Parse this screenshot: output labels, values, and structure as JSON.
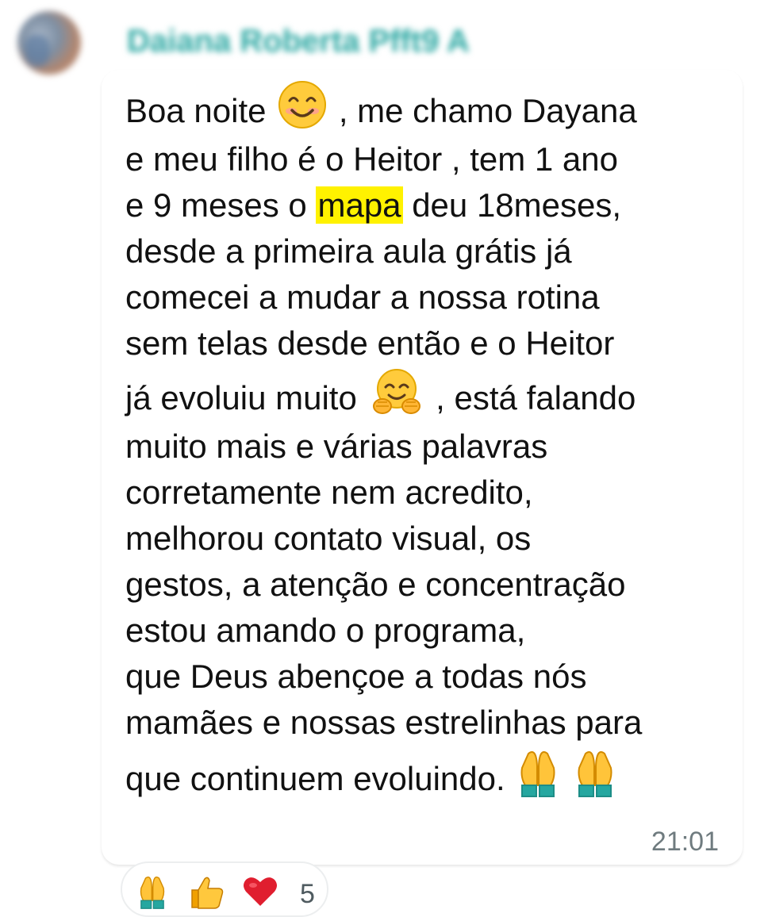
{
  "chat": {
    "sender_name": "Daiana Roberta Pfft9 A",
    "lines": [
      "Boa noite",
      ",  me chamo Dayana",
      "e meu filho é o Heitor , tem 1 ano",
      "e 9 meses o",
      "mapa",
      " deu 18meses,",
      "desde a primeira aula grátis já",
      "comecei a mudar a nossa rotina",
      "sem telas desde então e o Heitor",
      "já evoluiu muito",
      ", está falando",
      "muito mais e várias palavras",
      "corretamente nem acredito,",
      "melhorou contato visual, os",
      "gestos,  a atenção e concentração",
      "estou amando o programa,",
      "que Deus abençoe a todas nós",
      "mamães e nossas estrelinhas para",
      "que continuem evoluindo.",
      ""
    ],
    "time": "21:01",
    "reactions": {
      "count": "5",
      "icons": [
        "pray-icon",
        "thumbs-up-icon",
        "heart-icon"
      ]
    },
    "colors": {
      "sender": "#2aa7a2",
      "highlight": "#fff200",
      "text": "#111111",
      "meta": "#6f7b7f",
      "heart": "#e01e2f"
    }
  }
}
